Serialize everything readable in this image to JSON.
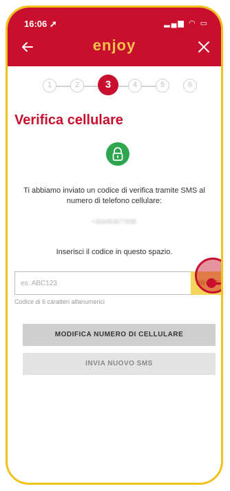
{
  "status_bar": {
    "time": "16:06 ➚",
    "icons": "▂▄▆ ◠ ▭"
  },
  "header": {
    "logo": "enjoy",
    "back_icon": "back-arrow-icon",
    "close_icon": "close-icon"
  },
  "stepper": {
    "steps": [
      "1",
      "2",
      "3",
      "4",
      "5",
      "6"
    ],
    "active": "3"
  },
  "page": {
    "title": "Verifica cellulare",
    "info": "Ti abbiamo inviato un codice di verifica tramite SMS al numero di telefono cellulare:",
    "phone": "+39345367783E",
    "instruction": "Inserisci il codice in questo spazio.",
    "code_placeholder": "es: ABC123",
    "code_hint": "Codice di 6 caratteri alfanumerici",
    "submit_label": "PROSE",
    "modify_label": "MODIFICA NUMERO DI CELLULARE",
    "resend_label": "INVIA NUOVO SMS"
  },
  "colors": {
    "brand": "#c8102e",
    "accent": "#f6d35b",
    "success": "#2ea54f",
    "frame": "#f2c21b"
  }
}
